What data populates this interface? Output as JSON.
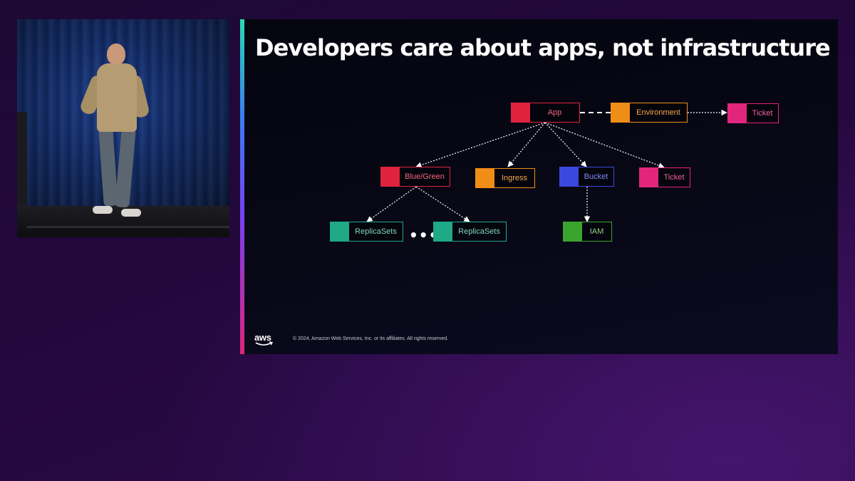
{
  "slide": {
    "title": "Developers care about apps, not infrastructure",
    "footer": {
      "logo_text": "aws",
      "copyright": "© 2024, Amazon Web Services, Inc. or its affiliates. All rights reserved."
    },
    "ellipsis": "•••",
    "diagram": {
      "nodes": {
        "app": {
          "label": "App",
          "color": "#e0233d"
        },
        "environment": {
          "label": "Environment",
          "color": "#f08d17"
        },
        "ticket_top": {
          "label": "Ticket",
          "color": "#e2267b"
        },
        "blue_green": {
          "label": "Blue/Green",
          "color": "#e0233d"
        },
        "ingress": {
          "label": "Ingress",
          "color": "#f08d17"
        },
        "bucket": {
          "label": "Bucket",
          "color": "#3b48e0"
        },
        "ticket": {
          "label": "Ticket",
          "color": "#e2267b"
        },
        "replicasets_1": {
          "label": "ReplicaSets",
          "color": "#1fa986"
        },
        "replicasets_2": {
          "label": "ReplicaSets",
          "color": "#1fa986"
        },
        "iam": {
          "label": "IAM",
          "color": "#3aa52c"
        }
      }
    }
  },
  "colors": {
    "background": "#24083d",
    "slide_background": "#07071a",
    "title_text": "#ffffff",
    "connector": "#ffffff"
  },
  "icons": {
    "logo": "aws-smile-logo"
  }
}
